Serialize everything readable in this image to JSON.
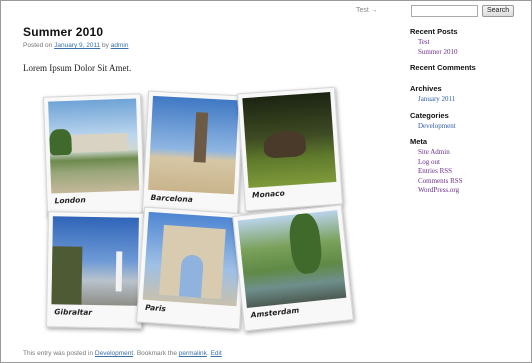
{
  "header": {
    "nav_link": "Test →",
    "search_button": "Search"
  },
  "post": {
    "title": "Summer 2010",
    "meta_prefix": "Posted on",
    "meta_date": "January 9, 2011",
    "meta_by": "by",
    "meta_author": "admin",
    "body": "Lorem Ipsum Dolor Sit Amet."
  },
  "photos": [
    {
      "caption": "London"
    },
    {
      "caption": "Barcelona"
    },
    {
      "caption": "Monaco"
    },
    {
      "caption": "Gibraltar"
    },
    {
      "caption": "Paris"
    },
    {
      "caption": "Amsterdam"
    }
  ],
  "sidebar": {
    "recent_posts_title": "Recent Posts",
    "recent_posts": [
      "Test",
      "Summer 2010"
    ],
    "recent_comments_title": "Recent Comments",
    "archives_title": "Archives",
    "archives": [
      "January 2011"
    ],
    "categories_title": "Categories",
    "categories": [
      "Development"
    ],
    "meta_title": "Meta",
    "meta": [
      "Site Admin",
      "Log out",
      "Entries RSS",
      "Comments RSS",
      "WordPress.org"
    ]
  },
  "footer": {
    "prefix": "This entry was posted in",
    "category": "Development",
    "middle": ". Bookmark the",
    "permalink": "permalink",
    "sep": ".",
    "edit": "Edit"
  }
}
